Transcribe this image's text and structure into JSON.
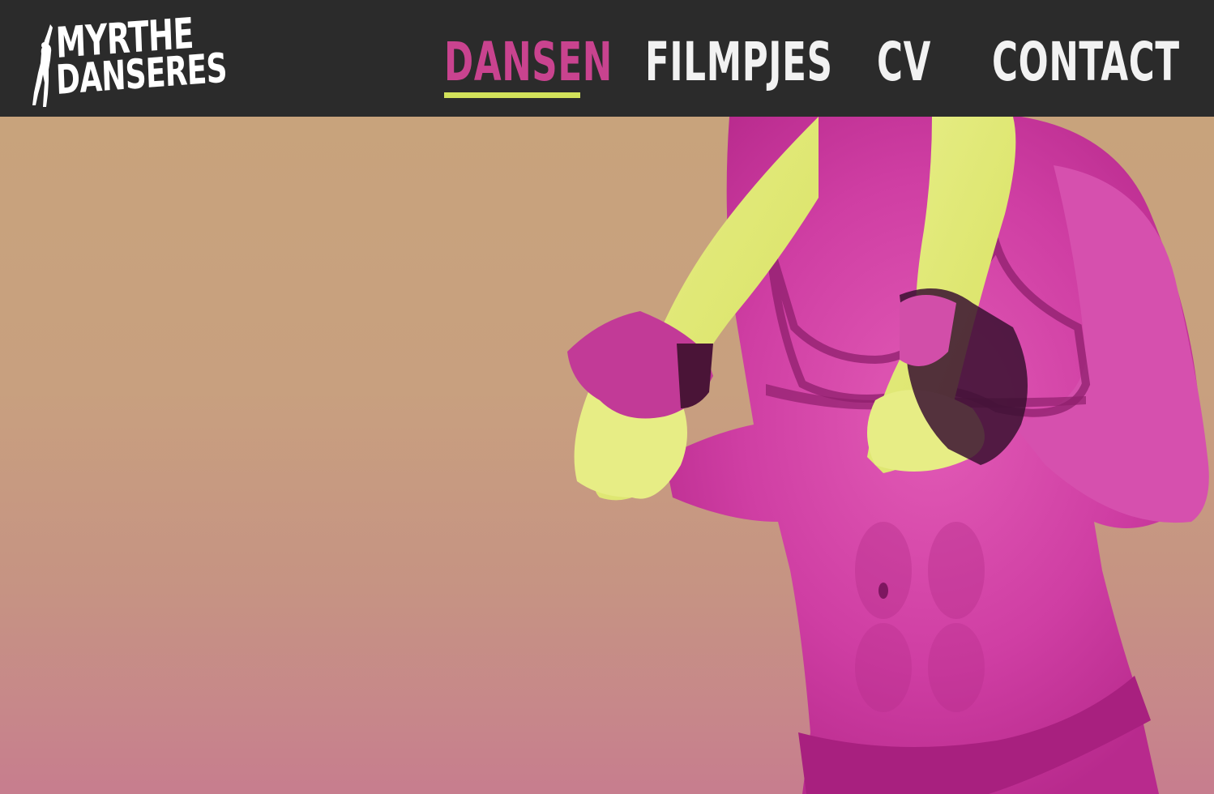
{
  "brand": {
    "line1": "MYRTHE",
    "line2": "DANSERES",
    "icon": "dancer-silhouette-icon"
  },
  "nav": {
    "items": [
      {
        "label": "DANSEN",
        "active": true
      },
      {
        "label": "FILMPJES",
        "active": false
      },
      {
        "label": "CV",
        "active": false
      },
      {
        "label": "CONTACT",
        "active": false
      }
    ]
  },
  "colors": {
    "header_bg": "#2b2b2b",
    "accent_pink": "#c9438f",
    "accent_lime": "#d2e25a",
    "background_tan": "#c8a37c"
  }
}
